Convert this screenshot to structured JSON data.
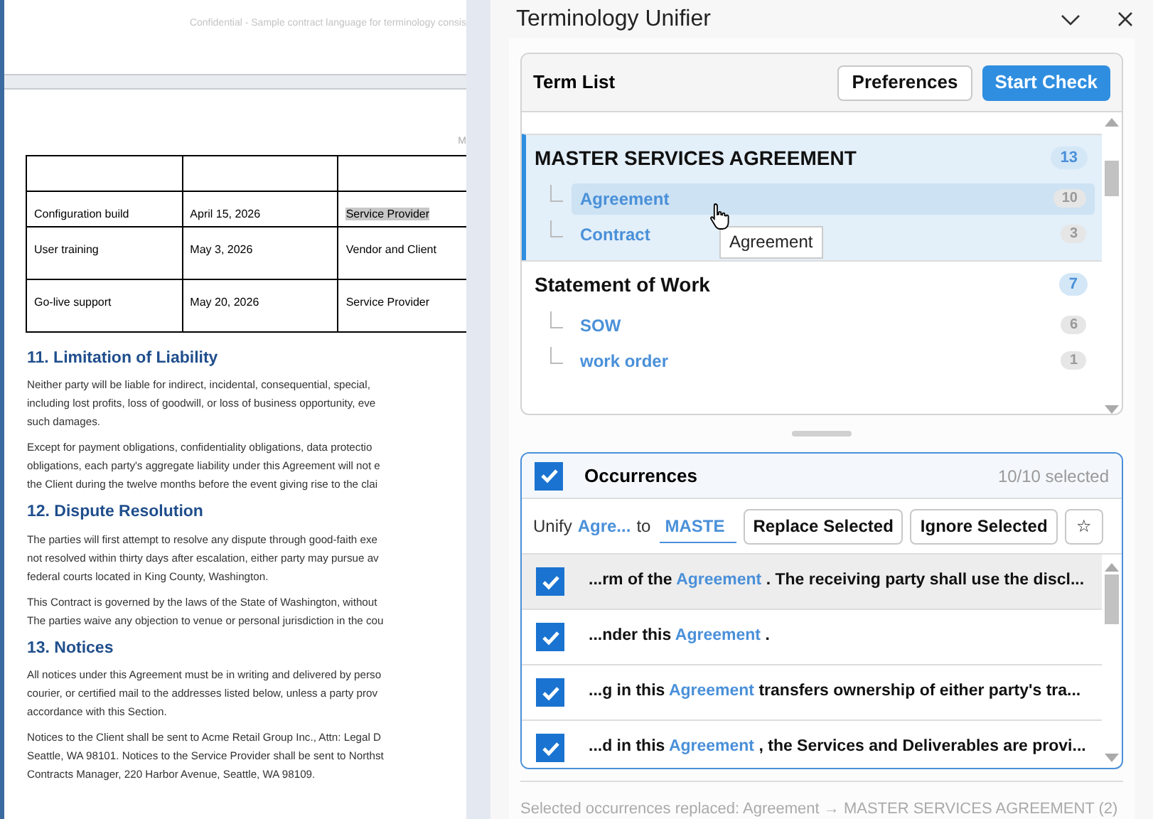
{
  "document": {
    "header": "Confidential - Sample contract language for terminology consis",
    "margin_mark": "M",
    "table": {
      "rows": [
        {
          "cells": [
            {
              "text": "Configuration build",
              "highlighted": false
            },
            {
              "text": "April 15, 2026",
              "highlighted": false
            },
            {
              "text": "Service Provider",
              "highlighted": true
            }
          ]
        },
        {
          "cells": [
            {
              "text": "User training",
              "highlighted": false
            },
            {
              "text": "May 3, 2026",
              "highlighted": false
            },
            {
              "text": "Vendor and Client",
              "highlighted": false
            }
          ]
        },
        {
          "cells": [
            {
              "text": "Go-live support",
              "highlighted": false
            },
            {
              "text": "May 20, 2026",
              "highlighted": false
            },
            {
              "text": "Service Provider",
              "highlighted": false
            }
          ]
        }
      ]
    },
    "sections": [
      {
        "heading": "11. Limitation of Liability",
        "paragraphs": [
          {
            "lines": [
              "Neither party will be liable for indirect, incidental, consequential, special,",
              "including lost profits, loss of goodwill, or loss of business opportunity, eve",
              "such damages."
            ]
          },
          {
            "lines": [
              "Except for payment obligations, confidentiality obligations, data protectio",
              "obligations, each party's aggregate liability under this Agreement will not e",
              "the Client during the twelve months before the event giving rise to the clai"
            ]
          }
        ]
      },
      {
        "heading": "12. Dispute Resolution",
        "paragraphs": [
          {
            "lines": [
              "The parties will first attempt to resolve any dispute through good-faith exe",
              "not resolved within thirty days after escalation, either party may pursue av",
              "federal courts located in King County, Washington."
            ]
          },
          {
            "lines": [
              "This Contract is governed by the laws of the State of Washington, without",
              "The parties waive any objection to venue or personal jurisdiction in the cou"
            ]
          }
        ]
      },
      {
        "heading": "13. Notices",
        "paragraphs": [
          {
            "lines": [
              "All notices under this Agreement must be in writing and delivered by perso",
              "courier, or certified mail to the addresses listed below, unless a party prov",
              "accordance with this Section."
            ]
          },
          {
            "lines": [
              "Notices to the Client shall be sent to Acme Retail Group Inc., Attn: Legal D",
              "Seattle, WA 98101. Notices to the Service Provider shall be sent to Northst",
              "Contracts Manager, 220 Harbor Avenue, Seattle, WA 98109."
            ]
          }
        ]
      }
    ]
  },
  "panel": {
    "title": "Terminology Unifier",
    "term_list": {
      "title": "Term List",
      "buttons": [
        {
          "label": "Preferences",
          "primary": false
        },
        {
          "label": "Start Check",
          "primary": true
        }
      ],
      "groups": [
        {
          "name": "MASTER SERVICES AGREEMENT",
          "count": "13",
          "selected": true,
          "children": [
            {
              "name": "Agreement",
              "count": "10",
              "selected": true
            },
            {
              "name": "Contract",
              "count": "3",
              "selected": false
            }
          ]
        },
        {
          "name": "Statement of Work",
          "count": "7",
          "selected": false,
          "children": [
            {
              "name": "SOW",
              "count": "6",
              "selected": false
            },
            {
              "name": "work order",
              "count": "1",
              "selected": false
            }
          ]
        }
      ],
      "tooltip": "Agreement"
    },
    "occurrences": {
      "title": "Occurrences",
      "checked": true,
      "selected_count": "10/10 selected",
      "unify_label": "Unify",
      "source_term": "Agre...",
      "to_label": "to",
      "target_value": "MASTE",
      "buttons": [
        "Replace Selected",
        "Ignore Selected",
        "☆"
      ],
      "rows": [
        {
          "before": "...rm of the",
          "term": "Agreement",
          "after": ". The receiving party shall use the discl...",
          "checked": true,
          "highlighted": true
        },
        {
          "before": "...nder this",
          "term": "Agreement",
          "after": ".",
          "checked": true,
          "highlighted": false
        },
        {
          "before": "...g in this",
          "term": "Agreement",
          "after": "transfers ownership of either party's tra...",
          "checked": true,
          "highlighted": false
        },
        {
          "before": "...d in this",
          "term": "Agreement",
          "after": ", the Services and Deliverables are provi...",
          "checked": true,
          "highlighted": false
        }
      ]
    },
    "status": "Selected occurrences replaced: Agreement → MASTER SERVICES AGREEMENT (2)"
  }
}
